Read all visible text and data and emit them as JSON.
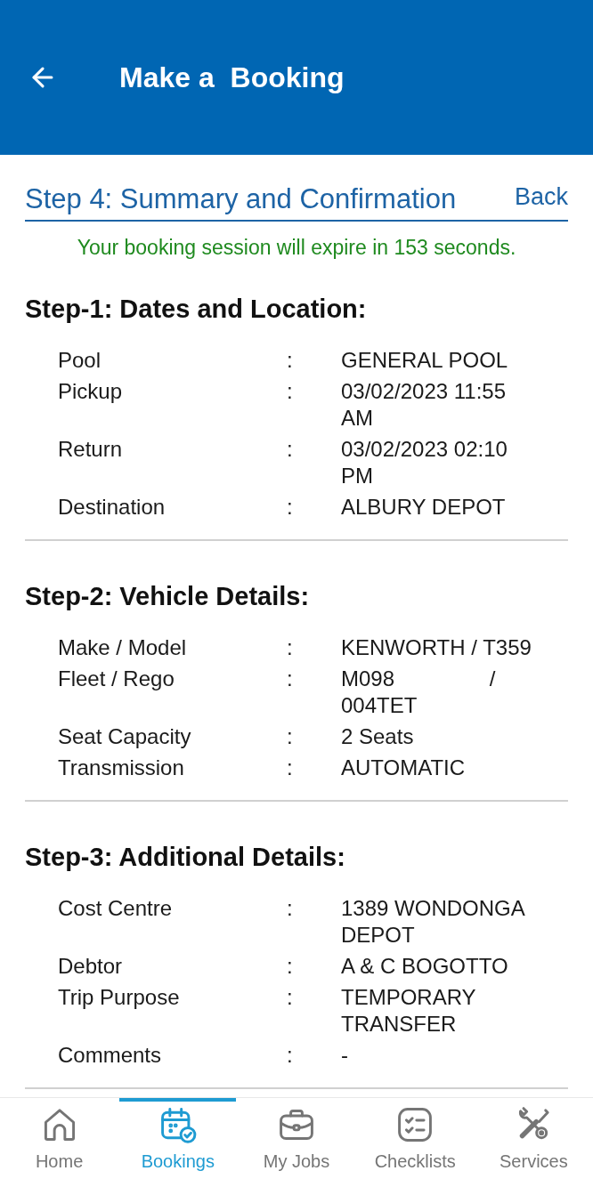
{
  "header": {
    "title": "Make a  Booking"
  },
  "step_bar": {
    "title": "Step 4: Summary and Confirmation",
    "back_link": "Back"
  },
  "session_notice": "Your booking session will expire in 153 seconds.",
  "sections": [
    {
      "heading": "Step-1: Dates and Location:",
      "rows": [
        {
          "label": "Pool",
          "separator": ":",
          "value": "GENERAL POOL"
        },
        {
          "label": "Pickup",
          "separator": ":",
          "value": "03/02/2023 11:55 AM"
        },
        {
          "label": "Return",
          "separator": ":",
          "value": "03/02/2023 02:10 PM"
        },
        {
          "label": "Destination",
          "separator": ":",
          "value": "ALBURY DEPOT"
        }
      ]
    },
    {
      "heading": "Step-2: Vehicle Details:",
      "rows": [
        {
          "label": "Make / Model",
          "separator": ":",
          "value": "KENWORTH / T359"
        },
        {
          "label": "Fleet / Rego",
          "separator": ":",
          "value": "M098                / 004TET"
        },
        {
          "label": "Seat Capacity",
          "separator": ":",
          "value": "2 Seats"
        },
        {
          "label": "Transmission",
          "separator": ":",
          "value": "AUTOMATIC"
        }
      ]
    },
    {
      "heading": "Step-3: Additional Details:",
      "rows": [
        {
          "label": "Cost Centre",
          "separator": ":",
          "value": "1389 WONDONGA DEPOT"
        },
        {
          "label": "Debtor",
          "separator": ":",
          "value": "A & C BOGOTTO"
        },
        {
          "label": "Trip Purpose",
          "separator": ":",
          "value": "TEMPORARY TRANSFER"
        },
        {
          "label": "Comments",
          "separator": ":",
          "value": "-"
        }
      ]
    }
  ],
  "bottom_nav": [
    {
      "kind": "home",
      "label": "Home",
      "selected": false
    },
    {
      "kind": "bookings",
      "label": "Bookings",
      "selected": true
    },
    {
      "kind": "jobs",
      "label": "My Jobs",
      "selected": false
    },
    {
      "kind": "checklists",
      "label": "Checklists",
      "selected": false
    },
    {
      "kind": "services",
      "label": "Services",
      "selected": false
    }
  ]
}
